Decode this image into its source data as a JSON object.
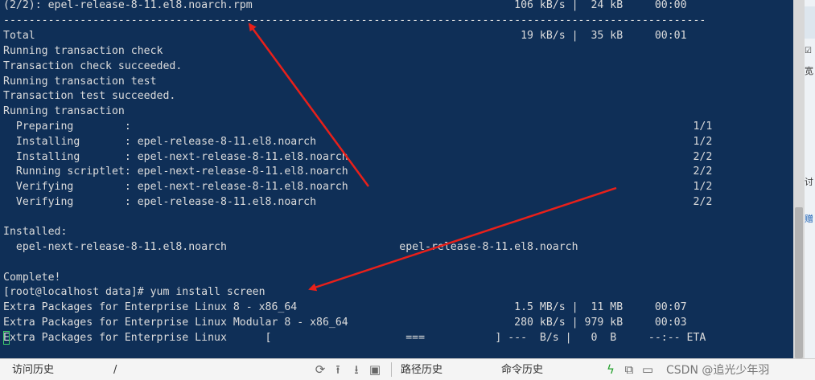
{
  "terminal": {
    "lines": [
      "(2/2): epel-release-8-11.el8.noarch.rpm                                         106 kB/s |  24 kB     00:00",
      "--------------------------------------------------------------------------------------------------------------",
      "Total                                                                            19 kB/s |  35 kB     00:01",
      "Running transaction check",
      "Transaction check succeeded.",
      "Running transaction test",
      "Transaction test succeeded.",
      "Running transaction",
      "  Preparing        :                                                                                        1/1",
      "  Installing       : epel-release-8-11.el8.noarch                                                           1/2",
      "  Installing       : epel-next-release-8-11.el8.noarch                                                      2/2",
      "  Running scriptlet: epel-next-release-8-11.el8.noarch                                                      2/2",
      "  Verifying        : epel-next-release-8-11.el8.noarch                                                      1/2",
      "  Verifying        : epel-release-8-11.el8.noarch                                                           2/2",
      "",
      "Installed:",
      "  epel-next-release-8-11.el8.noarch                           epel-release-8-11.el8.noarch",
      "",
      "Complete!",
      "[root@localhost data]# yum install screen",
      "Extra Packages for Enterprise Linux 8 - x86_64                                  1.5 MB/s |  11 MB     00:07",
      "Extra Packages for Enterprise Linux Modular 8 - x86_64                          280 kB/s | 979 kB     00:03",
      "Extra Packages for Enterprise Linux      [                     ===           ] ---  B/s |   0  B     --:-- ETA"
    ]
  },
  "right_panel": [
    "宽",
    "讨",
    "赠"
  ],
  "bottom_bar": {
    "history_label": "访问历史",
    "path_value": "/",
    "path_history_label": "路径历史",
    "cmd_history_label": "命令历史",
    "watermark": "CSDN @追光少年羽"
  },
  "colors": {
    "terminal_bg": "#0f2f57",
    "terminal_fg": "#dcdcdc",
    "arrow": "#e8201a",
    "lightning": "#22a02a"
  },
  "icons": [
    "refresh-icon",
    "upload-icon",
    "download-icon",
    "save-icon",
    "lightning-icon",
    "copy-icon",
    "clipboard-icon",
    "search-icon",
    "settings-icon"
  ]
}
